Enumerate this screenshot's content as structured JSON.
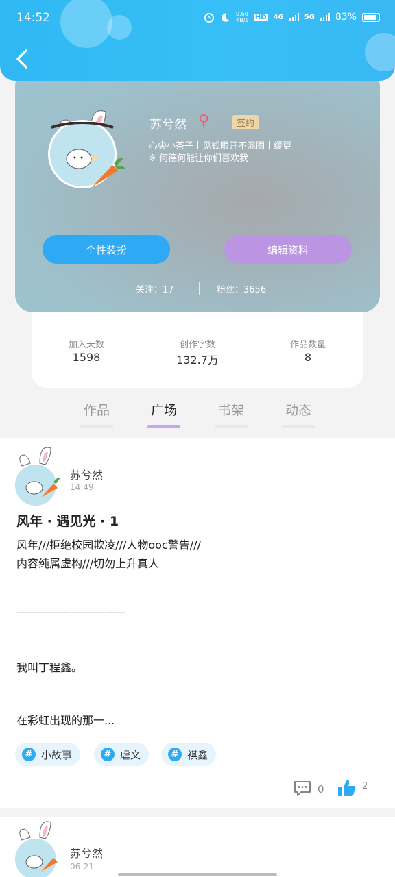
{
  "status_bar": {
    "time": "14:52",
    "net_speed": "0.60",
    "net_unit": "KB/s",
    "hd": "HD",
    "sim1": "4G",
    "sim2": "5G",
    "battery": "83%"
  },
  "header": {
    "back_icon": "chevron-left-icon"
  },
  "profile": {
    "nickname": "苏兮然",
    "gender_symbol": "♀",
    "signed_badge": "签约",
    "bio_line1": "心尖小茶子丨见钱眼开不混圈丨缓更",
    "bio_line2": "※ 何德何能让你们喜欢我",
    "style_button": "个性装扮",
    "edit_button": "编辑资料",
    "follow_label": "关注：17",
    "fans_label": "粉丝：3656"
  },
  "stats": [
    {
      "label": "加入天数",
      "value": "1598"
    },
    {
      "label": "创作字数",
      "value": "132.7万"
    },
    {
      "label": "作品数量",
      "value": "8"
    }
  ],
  "tabs": [
    {
      "label": "作品",
      "active": false
    },
    {
      "label": "广场",
      "active": true
    },
    {
      "label": "书架",
      "active": false
    },
    {
      "label": "动态",
      "active": false
    }
  ],
  "posts": [
    {
      "author": "苏兮然",
      "time": "14:49",
      "title": "风年 · 遇见光 · 1",
      "lines": [
        "风年///拒绝校园欺凌///人物ooc警告///",
        "内容纯属虚构///切勿上升真人",
        "——————————",
        "我叫丁程鑫。",
        "在彩虹出现的那一..."
      ],
      "tags": [
        "小故事",
        "虐文",
        "祺鑫"
      ],
      "comments": "0",
      "likes": "2"
    },
    {
      "author": "苏兮然",
      "time": "06-21"
    }
  ],
  "colors": {
    "header_blue": "#37bff6",
    "accent_blue": "#2ea9f4",
    "accent_purple": "#bb95e2",
    "tab_underline": "#c6a7e8"
  }
}
